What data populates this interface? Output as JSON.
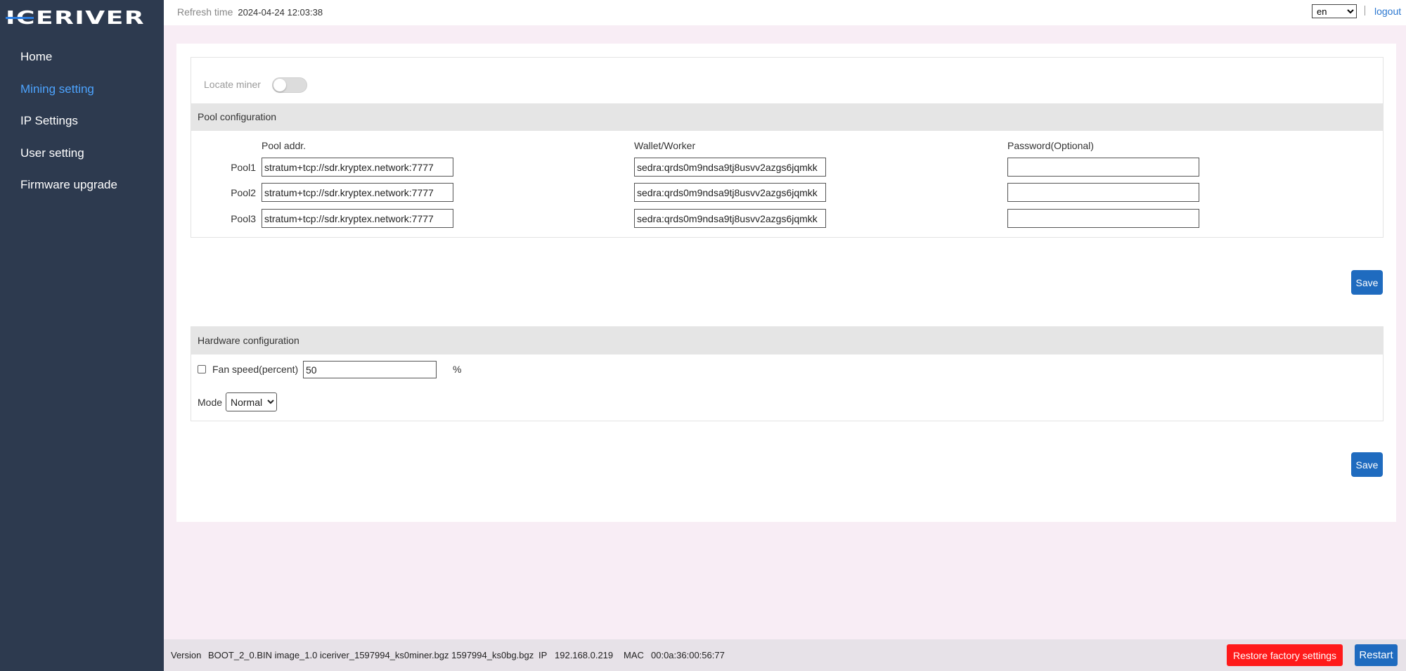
{
  "brand": {
    "logo_text": "ICERIVER",
    "accent_color": "#2b7de1"
  },
  "sidebar": {
    "items": [
      {
        "label": "Home",
        "active": false
      },
      {
        "label": "Mining setting",
        "active": true
      },
      {
        "label": "IP Settings",
        "active": false
      },
      {
        "label": "User setting",
        "active": false
      },
      {
        "label": "Firmware upgrade",
        "active": false
      }
    ]
  },
  "topbar": {
    "refresh_label": "Refresh time",
    "refresh_value": "2024-04-24 12:03:38",
    "language": "en",
    "logout_label": "logout"
  },
  "locate": {
    "label": "Locate miner",
    "enabled": false
  },
  "pool_config": {
    "title": "Pool configuration",
    "col_addr": "Pool addr.",
    "col_wallet": "Wallet/Worker",
    "col_password": "Password(Optional)",
    "pools": [
      {
        "label": "Pool1",
        "addr": "stratum+tcp://sdr.kryptex.network:7777",
        "wallet": "sedra:qrds0m9ndsa9tj8usvv2azgs6jqmkk",
        "password": ""
      },
      {
        "label": "Pool2",
        "addr": "stratum+tcp://sdr.kryptex.network:7777",
        "wallet": "sedra:qrds0m9ndsa9tj8usvv2azgs6jqmkk",
        "password": ""
      },
      {
        "label": "Pool3",
        "addr": "stratum+tcp://sdr.kryptex.network:7777",
        "wallet": "sedra:qrds0m9ndsa9tj8usvv2azgs6jqmkk",
        "password": ""
      }
    ],
    "save_label": "Save"
  },
  "hardware_config": {
    "title": "Hardware configuration",
    "fan_label": "Fan speed(percent)",
    "fan_value": "50",
    "fan_unit": "%",
    "fan_checked": false,
    "mode_label": "Mode",
    "mode_value": "Normal",
    "save_label": "Save"
  },
  "footer": {
    "version_label": "Version",
    "version_value": "BOOT_2_0.BIN image_1.0 iceriver_1597994_ks0miner.bgz 1597994_ks0bg.bgz",
    "ip_label": "IP",
    "ip_value": "192.168.0.219",
    "mac_label": "MAC",
    "mac_value": "00:0a:36:00:56:77",
    "restore_label": "Restore factory settings",
    "restart_label": "Restart"
  },
  "colors": {
    "sidebar_bg": "#2d3a4f",
    "primary_button": "#1f6bbf",
    "danger_button": "#ff1a1a",
    "page_bg": "#f8edf5"
  }
}
